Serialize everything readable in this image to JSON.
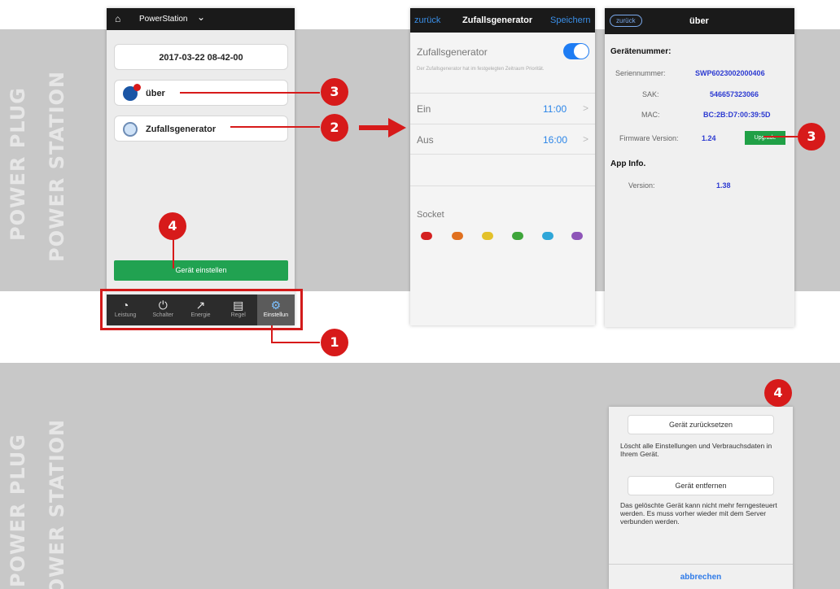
{
  "side_labels": {
    "top_1": "POWER PLUG",
    "top_2": "POWER STATION",
    "bottom_1": "POWER PLUG",
    "bottom_2": "POWER STATION"
  },
  "colors": {
    "accent_red": "#d71a1a",
    "green": "#21a251",
    "blue_link": "#2b85e8",
    "band_gray": "#c8c8c8"
  },
  "phone1": {
    "home_icon": "home-icon",
    "title": "PowerStation",
    "chevron_icon": "chevron-down-icon",
    "datetime": "2017-03-22 08-42-00",
    "about_label": "über",
    "random_label": "Zufallsgenerator",
    "setup_button": "Gerät einstellen",
    "tabs": [
      {
        "label": "Leistung",
        "icon": "gauge-icon"
      },
      {
        "label": "Schalter",
        "icon": "power-icon"
      },
      {
        "label": "Energie",
        "icon": "chart-icon"
      },
      {
        "label": "Regel",
        "icon": "schedule-icon"
      },
      {
        "label": "Einstellun",
        "icon": "gear-icon"
      }
    ]
  },
  "phone2": {
    "back": "zurück",
    "title": "Zufallsgenerator",
    "save": "Speichern",
    "toggle_label": "Zufallsgenerator",
    "toggle_on": true,
    "description": "Der Zufallsgenerator hat im festgelegten Zeitraum Priorität.",
    "on_label": "Ein",
    "on_time": "11:00",
    "off_label": "Aus",
    "off_time": "16:00",
    "chevron": ">",
    "socket_label": "Socket",
    "socket_colors": [
      "#d42020",
      "#e0701f",
      "#e3c12a",
      "#3ea53a",
      "#2fa6d8",
      "#8e55b8"
    ]
  },
  "phone3": {
    "back": "zurück",
    "title": "über",
    "device_heading": "Gerätenummer:",
    "serial_label": "Seriennummer:",
    "serial_value": "SWP6023002000406",
    "sak_label": "SAK:",
    "sak_value": "546657323066",
    "mac_label": "MAC:",
    "mac_value": "BC:2B:D7:00:39:5D",
    "fw_label": "Firmware Version:",
    "fw_value": "1.24",
    "upgrade_button": "Upgrade",
    "app_heading": "App Info.",
    "version_label": "Version:",
    "version_value": "1.38"
  },
  "dialog": {
    "reset_button": "Gerät zurücksetzen",
    "reset_text": "Löscht alle Einstellungen und Verbrauchsdaten in Ihrem Gerät.",
    "remove_button": "Gerät entfernen",
    "remove_text": "Das gelöschte Gerät kann nicht mehr ferngesteuert werden. Es muss vorher wieder mit dem Server verbunden werden.",
    "cancel": "abbrechen"
  },
  "markers": {
    "m1": "1",
    "m2": "2",
    "m3a": "3",
    "m3b": "3",
    "m4a": "4",
    "m4b": "4"
  }
}
